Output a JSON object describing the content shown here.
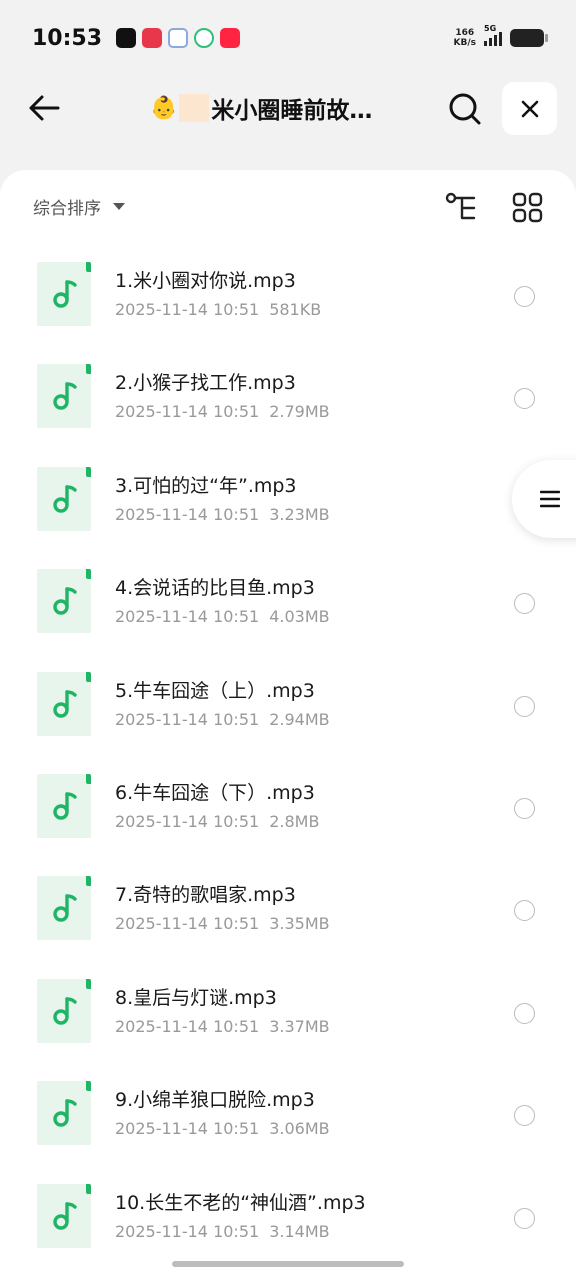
{
  "status_bar": {
    "time": "10:53",
    "net_speed_value": "166",
    "net_speed_unit": "KB/s",
    "network_type": "5G",
    "notification_icons": [
      {
        "name": "tiktok-icon",
        "color": "#111111"
      },
      {
        "name": "app-red-icon",
        "color": "#e8364a"
      },
      {
        "name": "app-cluster-icon",
        "color": "#ffffff"
      },
      {
        "name": "app-green-icon",
        "color": "#ffffff"
      },
      {
        "name": "xiaohongshu-icon",
        "color": "#ff2442"
      }
    ]
  },
  "header": {
    "title_emoji": "👶",
    "title_text": "米小圈睡前故…",
    "back_icon": "arrow-left-icon",
    "search_icon": "search-icon",
    "close_icon": "close-icon"
  },
  "toolbar": {
    "sort_label": "综合排序",
    "tree_icon": "tree-view-icon",
    "grid_icon": "grid-view-icon"
  },
  "accent_color": "#1fb565",
  "files": [
    {
      "name": "1.米小圈对你说.mp3",
      "date": "2025-11-14 10:51",
      "size": "581KB"
    },
    {
      "name": "2.小猴子找工作.mp3",
      "date": "2025-11-14 10:51",
      "size": "2.79MB"
    },
    {
      "name": "3.可怕的过“年”.mp3",
      "date": "2025-11-14 10:51",
      "size": "3.23MB"
    },
    {
      "name": "4.会说话的比目鱼.mp3",
      "date": "2025-11-14 10:51",
      "size": "4.03MB"
    },
    {
      "name": "5.牛车囧途（上）.mp3",
      "date": "2025-11-14 10:51",
      "size": "2.94MB"
    },
    {
      "name": "6.牛车囧途（下）.mp3",
      "date": "2025-11-14 10:51",
      "size": "2.8MB"
    },
    {
      "name": "7.奇特的歌唱家.mp3",
      "date": "2025-11-14 10:51",
      "size": "3.35MB"
    },
    {
      "name": "8.皇后与灯谜.mp3",
      "date": "2025-11-14 10:51",
      "size": "3.37MB"
    },
    {
      "name": "9.小绵羊狼口脱险.mp3",
      "date": "2025-11-14 10:51",
      "size": "3.06MB"
    },
    {
      "name": "10.长生不老的“神仙酒”.mp3",
      "date": "2025-11-14 10:51",
      "size": "3.14MB"
    }
  ]
}
